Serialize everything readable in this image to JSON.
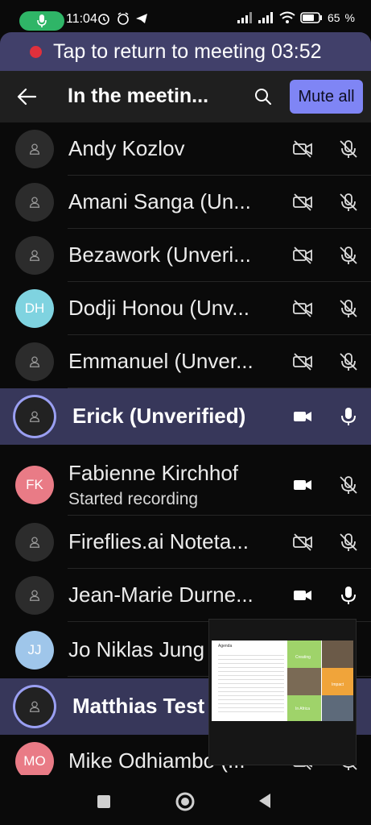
{
  "status_bar": {
    "time": "11:04",
    "battery": "65"
  },
  "banner": {
    "text": "Tap to return to meeting 03:52"
  },
  "header": {
    "title": "In the meetin...",
    "mute_all": "Mute all"
  },
  "participants": [
    {
      "name": "Andy Kozlov",
      "initials": "",
      "avatar_color": "#2c2c2c",
      "video": "off",
      "mic": "off"
    },
    {
      "name": "Amani Sanga (Un...",
      "initials": "",
      "avatar_color": "#2c2c2c",
      "video": "off",
      "mic": "off"
    },
    {
      "name": "Bezawork (Unveri...",
      "initials": "",
      "avatar_color": "#2c2c2c",
      "video": "off",
      "mic": "off"
    },
    {
      "name": "Dodji Honou (Unv...",
      "initials": "DH",
      "avatar_color": "#7fd3e0",
      "video": "off",
      "mic": "off"
    },
    {
      "name": "Emmanuel (Unver...",
      "initials": "",
      "avatar_color": "#2c2c2c",
      "video": "off",
      "mic": "off"
    },
    {
      "name": "Erick (Unverified)",
      "initials": "",
      "avatar_color": "#222222",
      "video": "on",
      "mic": "on",
      "selected": true
    },
    {
      "name": "Fabienne Kirchhof",
      "subtitle": "Started recording",
      "initials": "FK",
      "avatar_color": "#e97b86",
      "video": "on",
      "mic": "off"
    },
    {
      "name": "Fireflies.ai Noteta...",
      "initials": "",
      "avatar_color": "#2c2c2c",
      "video": "off",
      "mic": "off"
    },
    {
      "name": "Jean-Marie Durne...",
      "initials": "",
      "avatar_color": "#2c2c2c",
      "video": "on",
      "mic": "on"
    },
    {
      "name": "Jo Niklas Jung",
      "initials": "JJ",
      "avatar_color": "#9fc6ea",
      "video": "on",
      "mic": "on"
    },
    {
      "name": "Matthias Test",
      "initials": "",
      "avatar_color": "#222222",
      "video": "on",
      "mic": "on",
      "selected": true
    },
    {
      "name": "Mike Odhiambo (...",
      "initials": "MO",
      "avatar_color": "#e97b86",
      "video": "off",
      "mic": "off"
    }
  ],
  "pip": {
    "slide_title": "Agenda",
    "tiles": [
      "Creating",
      "Impact",
      "In Africa"
    ]
  }
}
